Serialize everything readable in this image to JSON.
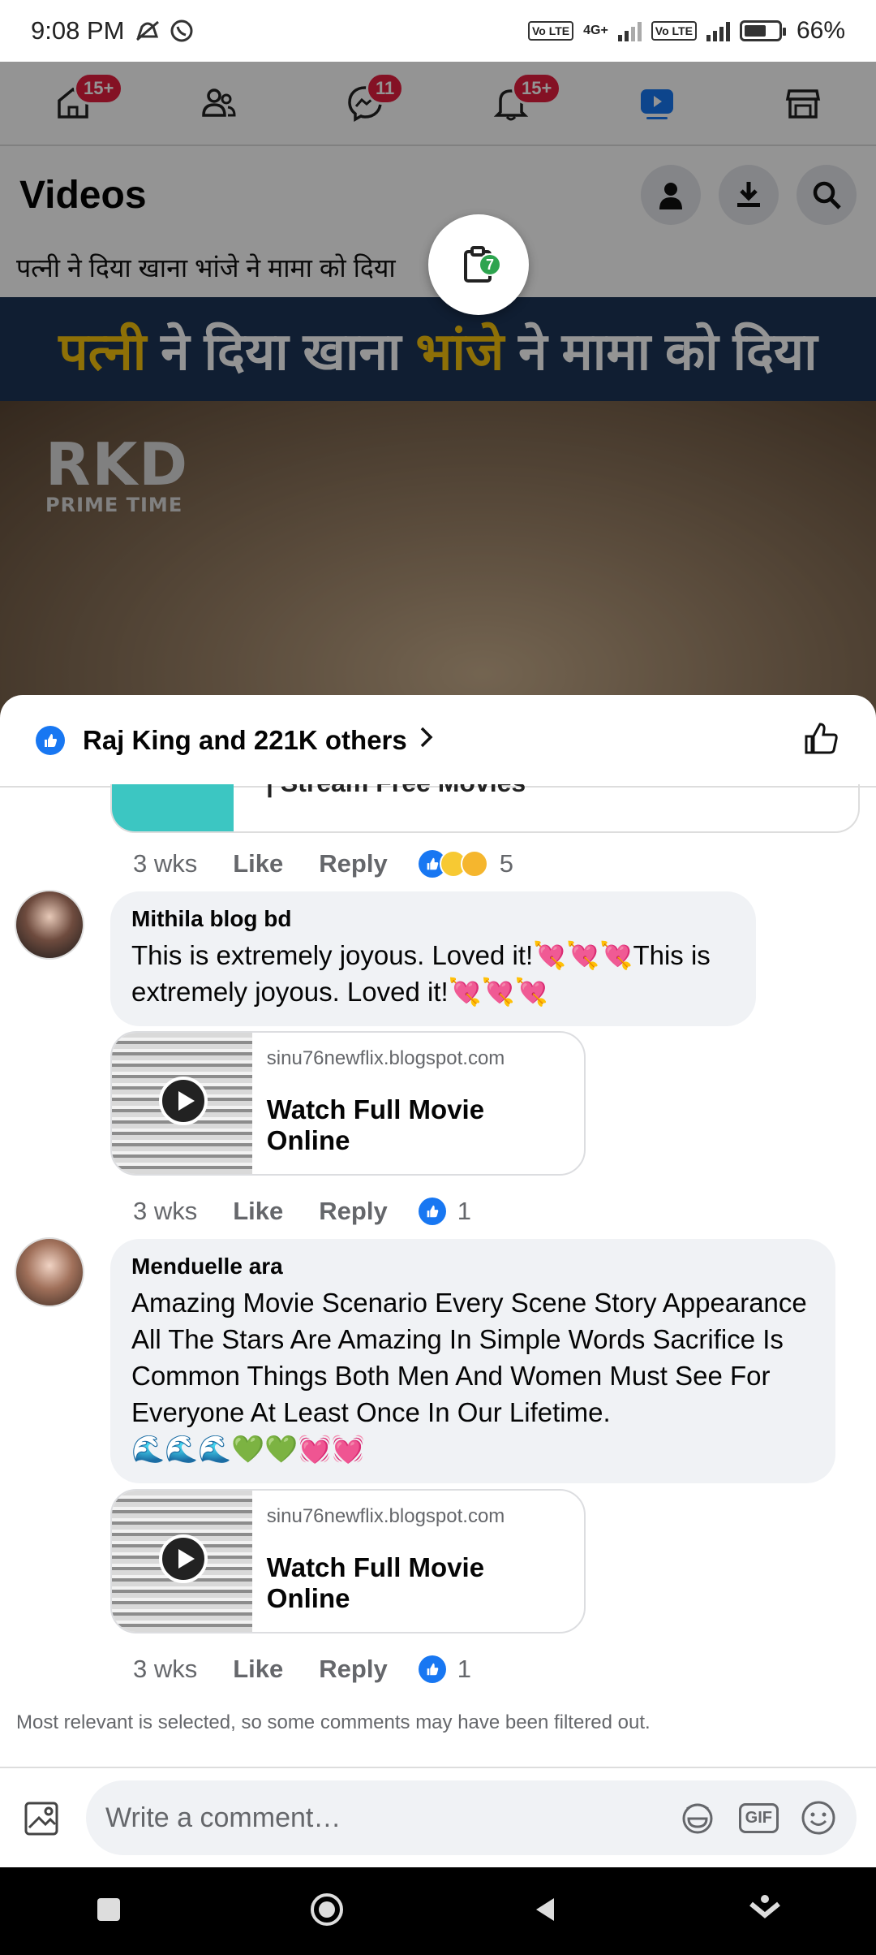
{
  "status_bar": {
    "time": "9:08 PM",
    "battery_label": "66%",
    "battery_level": 0.66,
    "network": "4G+",
    "lte_1": "Vo LTE",
    "lte_2": "Vo LTE"
  },
  "top_nav": {
    "items": [
      {
        "icon": "home-icon",
        "badge": "15+"
      },
      {
        "icon": "friends-icon",
        "badge": ""
      },
      {
        "icon": "messenger-icon",
        "badge": "11"
      },
      {
        "icon": "notifications-icon",
        "badge": "15+"
      },
      {
        "icon": "video-icon",
        "badge": ""
      },
      {
        "icon": "marketplace-icon",
        "badge": ""
      }
    ]
  },
  "header": {
    "title": "Videos"
  },
  "post": {
    "caption": "पत्नी ने दिया खाना भांजे ने मामा को दिया",
    "video_banner_part1": "पत्नी",
    "video_banner_part2": " ने दिया खाना ",
    "video_banner_part3": "भांजे",
    "video_banner_part4": " ने मामा को दिया",
    "watermark_big": "RKD",
    "watermark_small": "PRIME TIME",
    "clipboard_badge": "7"
  },
  "sheet": {
    "reactions_summary": "Raj King and 221K others",
    "previous_link_title": "| Stream Free Movies",
    "previous_meta": {
      "time": "3 wks",
      "like": "Like",
      "reply": "Reply",
      "count": "5"
    },
    "comments": [
      {
        "author": "Mithila blog bd",
        "text": "This is extremely joyous. Loved it!💘💘💘This is extremely joyous. Loved it!💘💘💘",
        "link_domain": "sinu76newflix.blogspot.com",
        "link_title": "Watch Full Movie Online",
        "time": "3 wks",
        "like": "Like",
        "reply": "Reply",
        "count": "1"
      },
      {
        "author": "Menduelle ara",
        "text": "Amazing Movie Scenario Every Scene Story Appearance All The Stars Are Amazing In Simple Words Sacrifice Is Common Things Both Men And Women Must See For Everyone At Least Once In Our Lifetime.",
        "emoji_line": "🌊🌊🌊💚💚💓💓",
        "link_domain": "sinu76newflix.blogspot.com",
        "link_title": "Watch Full Movie Online",
        "time": "3 wks",
        "like": "Like",
        "reply": "Reply",
        "count": "1"
      }
    ],
    "filter_note": "Most relevant is selected, so some comments may have been filtered out.",
    "composer_placeholder": "Write a comment…",
    "gif_label": "GIF"
  },
  "colors": {
    "facebook_blue": "#1877f2",
    "badge_red": "#e41e3f",
    "bubble_gray": "#f0f2f5"
  }
}
